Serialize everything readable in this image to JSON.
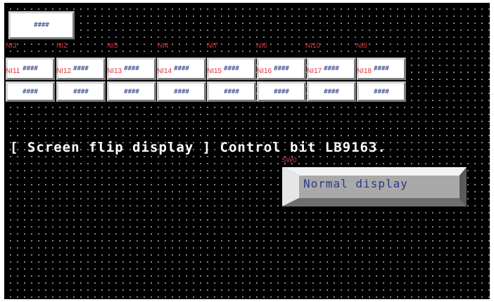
{
  "display": {
    "top_field": "####",
    "row1_labels": [
      "NI3",
      "NI2",
      "NI5",
      "NI4",
      "NI7",
      "NI6",
      "NI10",
      "NI8"
    ],
    "row2_labels": [
      "NI11",
      "NI12",
      "NI13",
      "NI14",
      "NI15",
      "NI16",
      "NI17",
      "NI18"
    ],
    "row2_values": [
      "####",
      "####",
      "####",
      "####",
      "####",
      "####",
      "####",
      "####"
    ],
    "row3_values": [
      "####",
      "####",
      "####",
      "####",
      "####",
      "####",
      "####",
      "####"
    ]
  },
  "caption": "[ Screen flip display ]  Control bit LB9163.",
  "switch": {
    "tag": "SW0",
    "label": "Normal display"
  },
  "colors": {
    "background": "#000000",
    "grid_dot": "#9a9a9a",
    "tag_text": "#e0323a",
    "field_text": "#4a5a9a",
    "caption_text": "#ffffff",
    "switch_face": "#a9a9a9"
  }
}
